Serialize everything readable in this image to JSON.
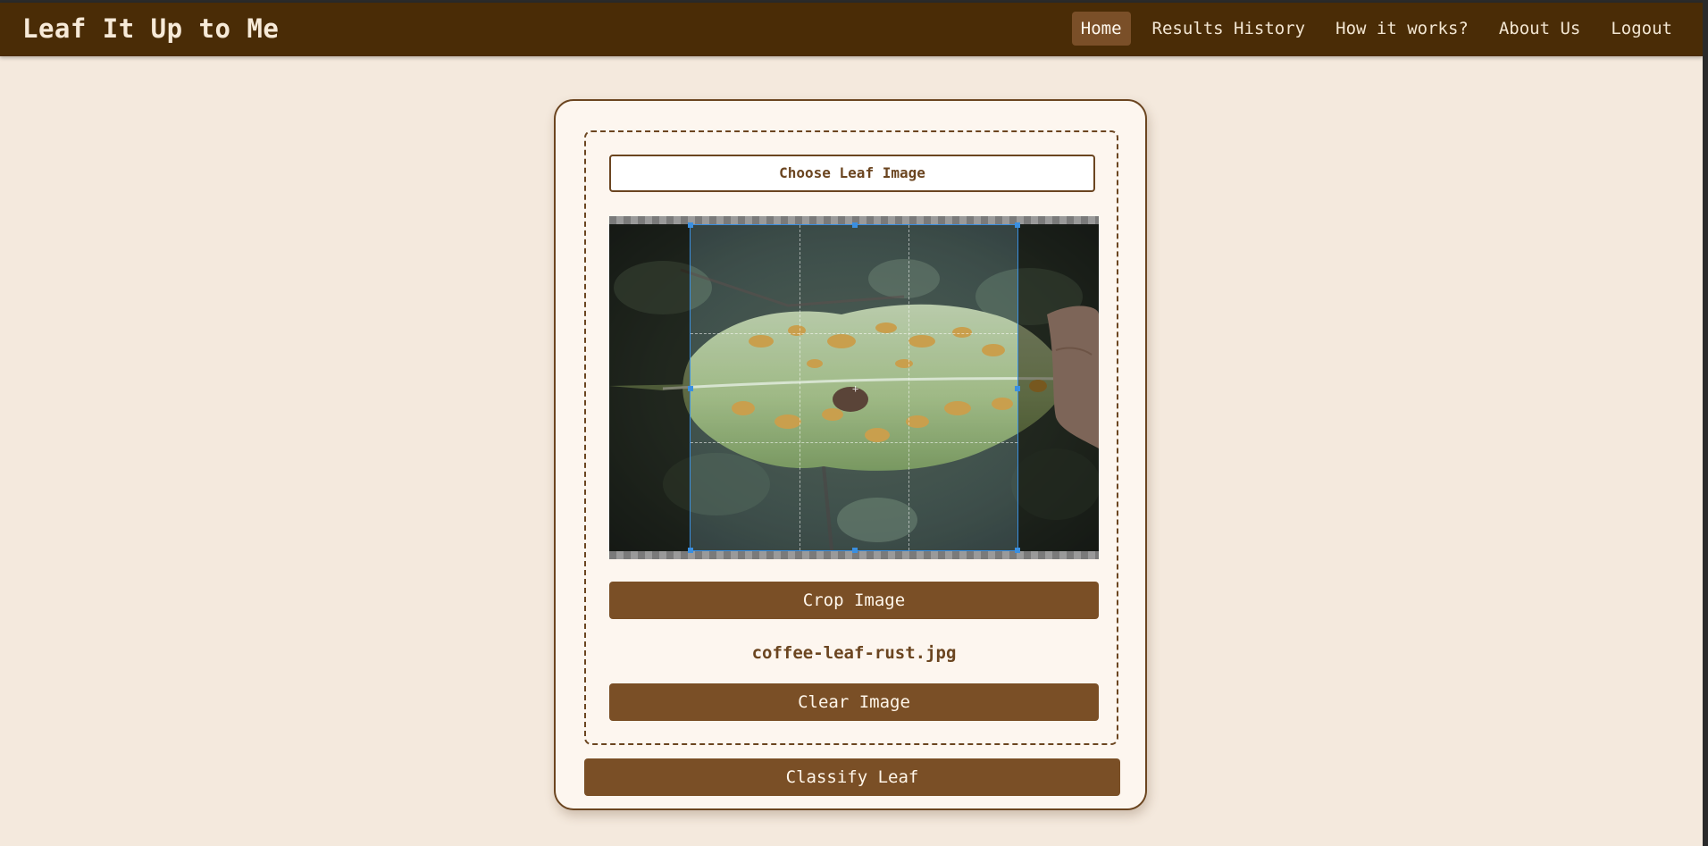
{
  "app": {
    "brand": "Leaf It Up to Me"
  },
  "nav": {
    "items": [
      {
        "label": "Home",
        "active": true
      },
      {
        "label": "Results History",
        "active": false
      },
      {
        "label": "How it works?",
        "active": false
      },
      {
        "label": "About Us",
        "active": false
      },
      {
        "label": "Logout",
        "active": false
      }
    ]
  },
  "upload": {
    "choose_label": "Choose Leaf Image",
    "crop_label": "Crop Image",
    "filename": "coffee-leaf-rust.jpg",
    "clear_label": "Clear Image"
  },
  "classify_label": "Classify Leaf",
  "colors": {
    "navbar": "#4a2c06",
    "page_background": "#f4e9dd",
    "button": "#7a4f26",
    "crop_selection": "#3a8fe0"
  }
}
